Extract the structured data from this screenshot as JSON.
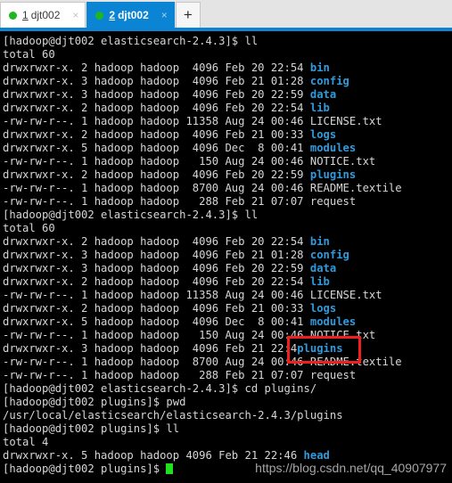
{
  "window": {
    "background": "#000000",
    "accent": "#0b84d4",
    "dir_color": "#2f9bdd",
    "fg_color": "#d6d6d6",
    "highlight_color": "#f01f1f",
    "cursor_color": "#1ee01e"
  },
  "tabbar": {
    "tabs": [
      {
        "number": "1",
        "label": "djt002",
        "close": "×",
        "active": false,
        "status_dot": "green-dot-icon"
      },
      {
        "number": "2",
        "label": "djt002",
        "close": "×",
        "active": true,
        "status_dot": "green-dot-icon"
      }
    ],
    "new_tab_label": "+"
  },
  "terminal": {
    "lines": [
      {
        "text": "[hadoop@djt002 elasticsearch-2.4.3]$ ll"
      },
      {
        "text": "total 60"
      },
      {
        "text": "drwxrwxr-x. 2 hadoop hadoop  4096 Feb 20 22:54 ",
        "name": "bin",
        "is_dir": true
      },
      {
        "text": "drwxrwxr-x. 3 hadoop hadoop  4096 Feb 21 01:28 ",
        "name": "config",
        "is_dir": true
      },
      {
        "text": "drwxrwxr-x. 3 hadoop hadoop  4096 Feb 20 22:59 ",
        "name": "data",
        "is_dir": true
      },
      {
        "text": "drwxrwxr-x. 2 hadoop hadoop  4096 Feb 20 22:54 ",
        "name": "lib",
        "is_dir": true
      },
      {
        "text": "-rw-rw-r--. 1 hadoop hadoop 11358 Aug 24 00:46 ",
        "name": "LICENSE.txt",
        "is_dir": false
      },
      {
        "text": "drwxrwxr-x. 2 hadoop hadoop  4096 Feb 21 00:33 ",
        "name": "logs",
        "is_dir": true
      },
      {
        "text": "drwxrwxr-x. 5 hadoop hadoop  4096 Dec  8 00:41 ",
        "name": "modules",
        "is_dir": true
      },
      {
        "text": "-rw-rw-r--. 1 hadoop hadoop   150 Aug 24 00:46 ",
        "name": "NOTICE.txt",
        "is_dir": false
      },
      {
        "text": "drwxrwxr-x. 2 hadoop hadoop  4096 Feb 20 22:59 ",
        "name": "plugins",
        "is_dir": true
      },
      {
        "text": "-rw-rw-r--. 1 hadoop hadoop  8700 Aug 24 00:46 ",
        "name": "README.textile",
        "is_dir": false
      },
      {
        "text": "-rw-rw-r--. 1 hadoop hadoop   288 Feb 21 07:07 ",
        "name": "request",
        "is_dir": false
      },
      {
        "text": "[hadoop@djt002 elasticsearch-2.4.3]$ ll"
      },
      {
        "text": "total 60"
      },
      {
        "text": "drwxrwxr-x. 2 hadoop hadoop  4096 Feb 20 22:54 ",
        "name": "bin",
        "is_dir": true
      },
      {
        "text": "drwxrwxr-x. 3 hadoop hadoop  4096 Feb 21 01:28 ",
        "name": "config",
        "is_dir": true
      },
      {
        "text": "drwxrwxr-x. 3 hadoop hadoop  4096 Feb 20 22:59 ",
        "name": "data",
        "is_dir": true
      },
      {
        "text": "drwxrwxr-x. 2 hadoop hadoop  4096 Feb 20 22:54 ",
        "name": "lib",
        "is_dir": true
      },
      {
        "text": "-rw-rw-r--. 1 hadoop hadoop 11358 Aug 24 00:46 ",
        "name": "LICENSE.txt",
        "is_dir": false
      },
      {
        "text": "drwxrwxr-x. 2 hadoop hadoop  4096 Feb 21 00:33 ",
        "name": "logs",
        "is_dir": true
      },
      {
        "text": "drwxrwxr-x. 5 hadoop hadoop  4096 Dec  8 00:41 ",
        "name": "modules",
        "is_dir": true
      },
      {
        "text": "-rw-rw-r--. 1 hadoop hadoop   150 Aug 24 00:46 ",
        "name": "NOTICE.txt",
        "is_dir": false
      },
      {
        "text": "drwxrwxr-x. 3 hadoop hadoop  4096 Feb 21 22:4",
        "name": "plugins",
        "is_dir": true
      },
      {
        "text": "-rw-rw-r--. 1 hadoop hadoop  8700 Aug 24 00:46 ",
        "name": "README.textile",
        "is_dir": false
      },
      {
        "text": "-rw-rw-r--. 1 hadoop hadoop   288 Feb 21 07:07 ",
        "name": "request",
        "is_dir": false
      },
      {
        "text": "[hadoop@djt002 elasticsearch-2.4.3]$ cd plugins/"
      },
      {
        "text": "[hadoop@djt002 plugins]$ pwd"
      },
      {
        "text": "/usr/local/elasticsearch/elasticsearch-2.4.3/plugins"
      },
      {
        "text": "[hadoop@djt002 plugins]$ ll"
      },
      {
        "text": "total 4"
      },
      {
        "text": "drwxrwxr-x. 5 hadoop hadoop 4096 Feb 21 22:46 ",
        "name": "head",
        "is_dir": true
      },
      {
        "text": "[hadoop@djt002 plugins]$ ",
        "cursor": true
      }
    ]
  },
  "annotation": {
    "highlight_target": "plugins",
    "shape": "rectangle"
  },
  "watermark": {
    "text": "https://blog.csdn.net/qq_40907977"
  }
}
